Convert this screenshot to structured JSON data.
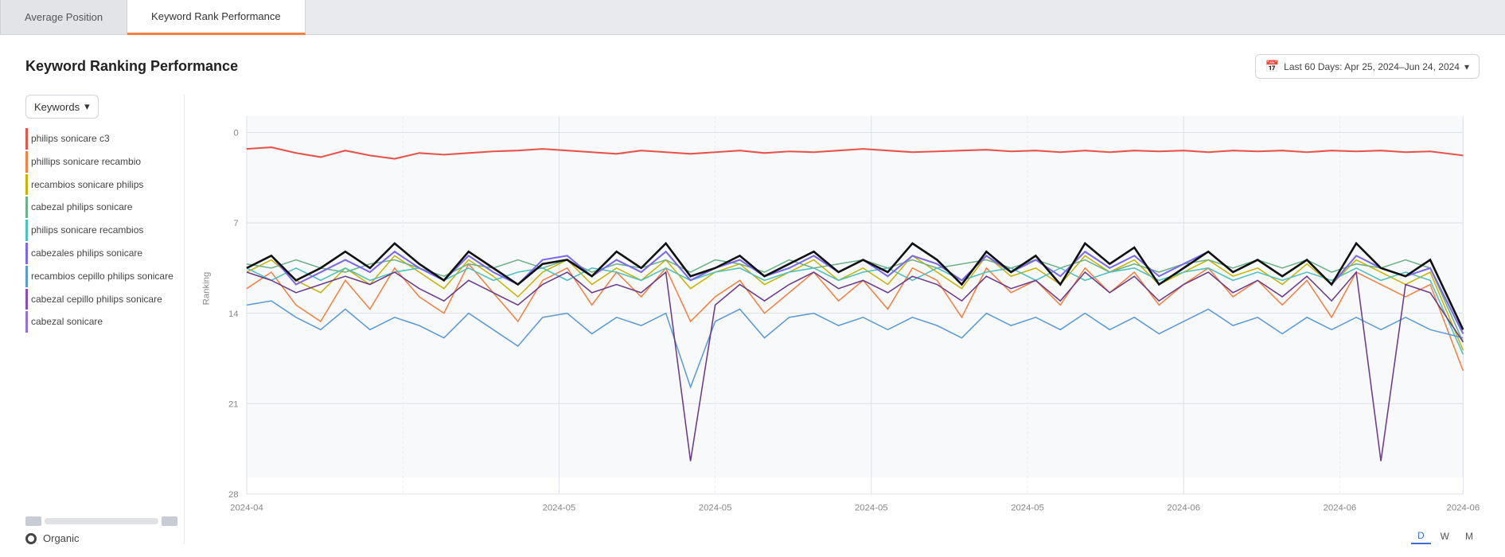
{
  "tabs": [
    {
      "id": "avg-position",
      "label": "Average Position",
      "active": false
    },
    {
      "id": "keyword-rank",
      "label": "Keyword Rank Performance",
      "active": true
    }
  ],
  "page": {
    "title": "Keyword Ranking Performance",
    "date_filter": "Last 60 Days: Apr 25, 2024–Jun 24, 2024"
  },
  "keywords_dropdown": {
    "label": "Keywords",
    "chevron": "▾"
  },
  "keywords": [
    {
      "id": "k1",
      "text": "philips sonicare c3",
      "color": "#e8534a"
    },
    {
      "id": "k2",
      "text": "phillips sonicare recambio",
      "color": "#f5813f"
    },
    {
      "id": "k3",
      "text": "recambios sonicare philips",
      "color": "#c8b400"
    },
    {
      "id": "k4",
      "text": "cabezal philips sonicare",
      "color": "#6ab187"
    },
    {
      "id": "k5",
      "text": "philips sonicare recambios",
      "color": "#4dc0c0"
    },
    {
      "id": "k6",
      "text": "cabezales philips sonicare",
      "color": "#7b68ee"
    },
    {
      "id": "k7",
      "text": "recambios cepillo philips sonicare",
      "color": "#5b9bd5"
    },
    {
      "id": "k8",
      "text": "cabezal cepillo philips sonicare",
      "color": "#8b4ac0"
    },
    {
      "id": "k9",
      "text": "cabezal sonicare",
      "color": "#9370db"
    }
  ],
  "organic": "Organic",
  "chart": {
    "y_labels": [
      "0",
      "7",
      "14",
      "21",
      "28"
    ],
    "x_labels": [
      "2024-04",
      "2024-05",
      "2024-05",
      "2024-05",
      "2024-05",
      "2024-06",
      "2024-06",
      "2024-06"
    ],
    "y_axis_label": "Ranking"
  },
  "dwm": {
    "buttons": [
      {
        "label": "D",
        "active": true
      },
      {
        "label": "W",
        "active": false
      },
      {
        "label": "M",
        "active": false
      }
    ]
  }
}
